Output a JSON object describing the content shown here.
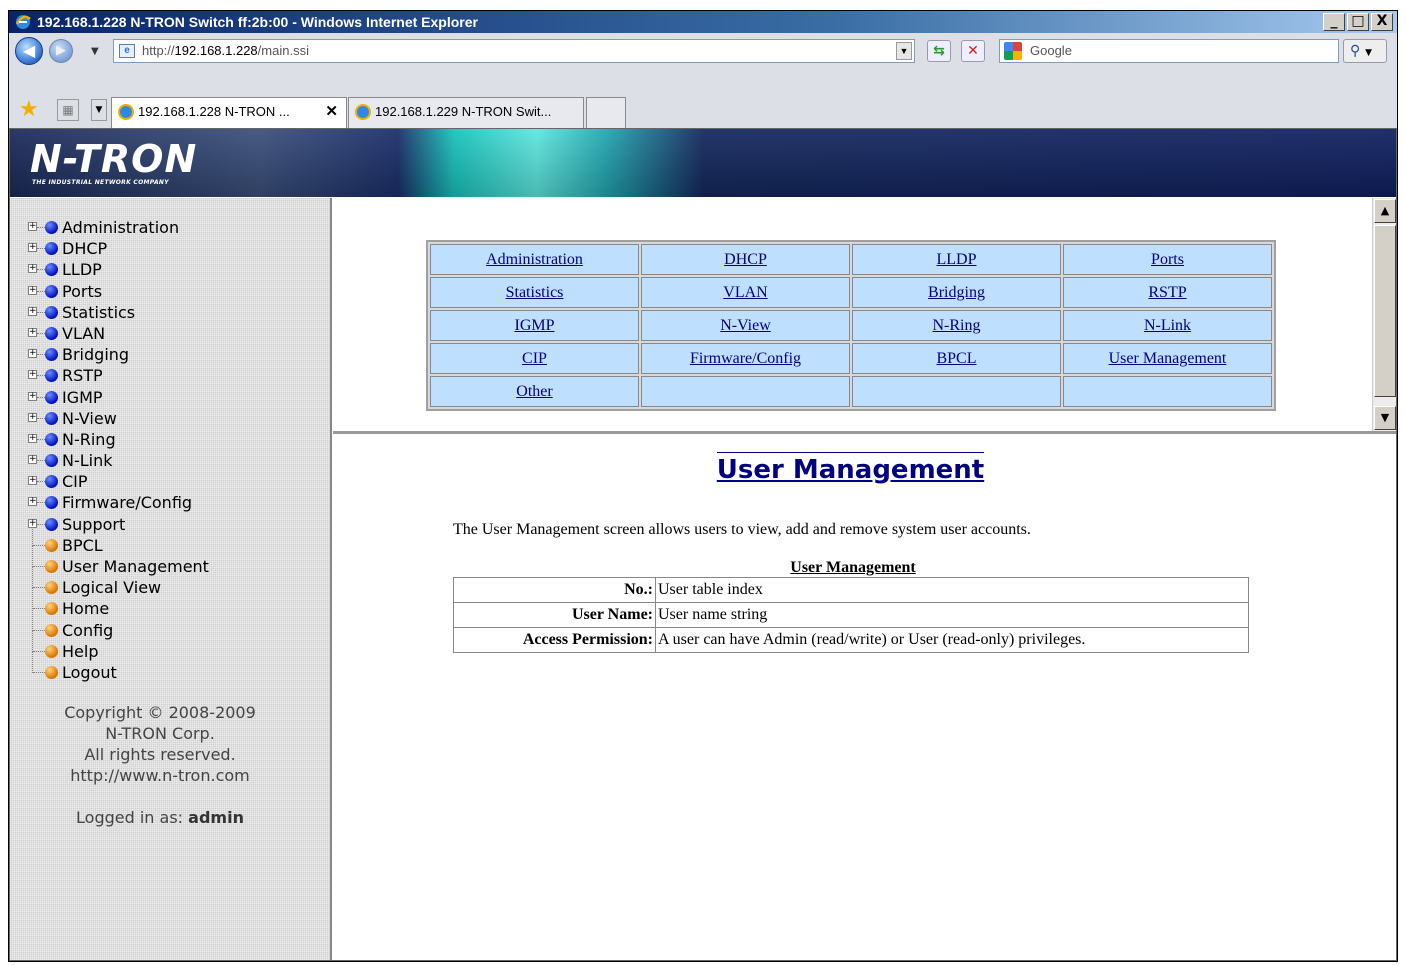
{
  "window": {
    "title": "192.168.1.228 N-TRON Switch ff:2b:00 - Windows Internet Explorer",
    "minimize": "_",
    "maximize": "□",
    "close": "X"
  },
  "addressbar": {
    "url_prefix": "http://",
    "url_host": "192.168.1.228",
    "url_path": "/main.ssi",
    "search_placeholder": "Google"
  },
  "tabs": [
    {
      "label": "192.168.1.228 N-TRON ..."
    },
    {
      "label": "192.168.1.229 N-TRON Swit..."
    }
  ],
  "banner": {
    "logo": "N-TRON",
    "tagline": "THE INDUSTRIAL NETWORK COMPANY"
  },
  "sidebar": {
    "folders": [
      "Administration",
      "DHCP",
      "LLDP",
      "Ports",
      "Statistics",
      "VLAN",
      "Bridging",
      "RSTP",
      "IGMP",
      "N-View",
      "N-Ring",
      "N-Link",
      "CIP",
      "Firmware/Config",
      "Support"
    ],
    "pages": [
      "BPCL",
      "User Management",
      "Logical View",
      "Home",
      "Config",
      "Help",
      "Logout"
    ],
    "copyright_lines": [
      "Copyright © 2008-2009",
      "N-TRON Corp.",
      "All rights reserved.",
      "http://www.n-tron.com"
    ],
    "logged_in_label": "Logged in as:",
    "logged_in_user": "admin"
  },
  "link_grid": [
    [
      "Administration",
      "DHCP",
      "LLDP",
      "Ports"
    ],
    [
      "Statistics",
      "VLAN",
      "Bridging",
      "RSTP"
    ],
    [
      "IGMP",
      "N-View",
      "N-Ring",
      "N-Link"
    ],
    [
      "CIP",
      "Firmware/Config",
      "BPCL",
      "User Management"
    ],
    [
      "Other",
      "",
      "",
      ""
    ]
  ],
  "main": {
    "title": "User Management",
    "description": "The User Management screen allows users to view, add and remove system user accounts.",
    "table_title": "User Management",
    "rows": [
      {
        "key": "No.:",
        "value": "User table index"
      },
      {
        "key": "User Name:",
        "value": "User name string"
      },
      {
        "key": "Access Permission:",
        "value": "A user can have Admin (read/write) or User (read-only) privileges."
      }
    ]
  },
  "colors": {
    "titlebar": "#0a246a",
    "link": "#000080",
    "grid_cell": "#bfdfff"
  }
}
